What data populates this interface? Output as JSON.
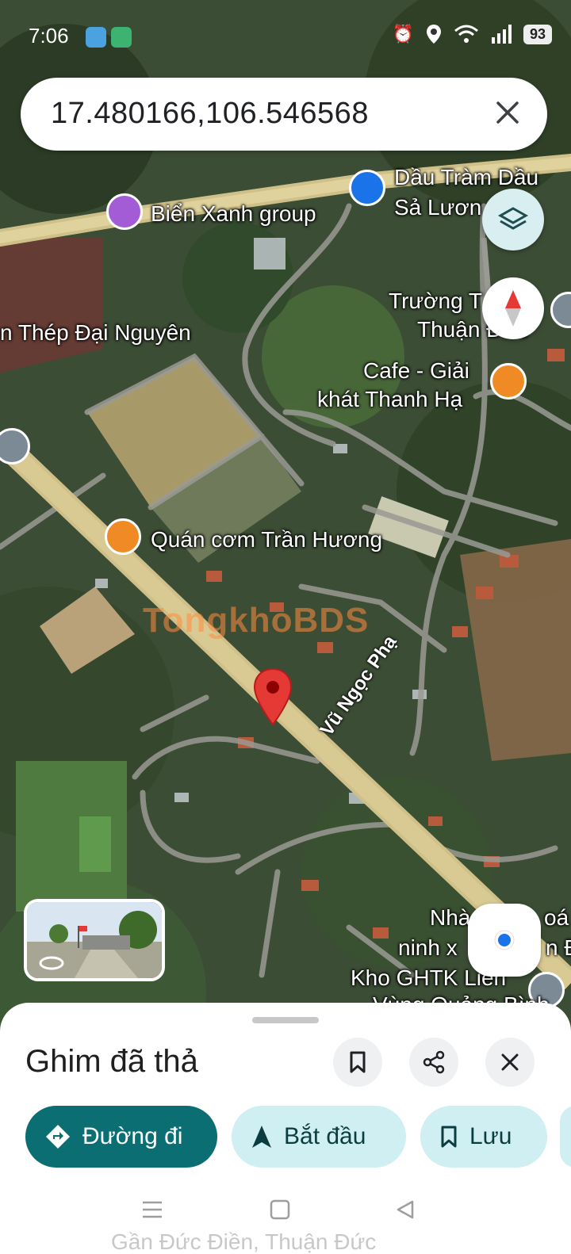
{
  "status_bar": {
    "time": "7:06",
    "battery": "93"
  },
  "search": {
    "query": "17.480166,106.546568"
  },
  "map": {
    "labels": {
      "bien_xanh": "Biển Xanh group",
      "dau_tram_1": "Dầu Tràm Dầu",
      "dau_tram_2": "Sả Lươn",
      "dai_nguyen": "n Thép Đại Nguyên",
      "truong_1": "Trường T",
      "truong_2": "Thuận Đức",
      "cafe_1": "Cafe - Giải",
      "cafe_2": "khát Thanh Hạ",
      "quan_com": "Quán cơm Trần Hương",
      "street": "Vũ Ngọc Phạ",
      "nha_1": "Nhà",
      "nha_1b": "oá",
      "nha_2": "ninh x",
      "nha_2b": "n Đ",
      "kho": "Kho GHTK Liên",
      "vung": "Vùng Quảng Bình"
    },
    "watermark": "TongkhoBDS"
  },
  "sheet": {
    "title": "Ghim đã thả",
    "chips": {
      "directions": "Đường đi",
      "start": "Bắt đầu",
      "save": "Lưu"
    },
    "faded_address": "Gần Đức Điền, Thuận Đức"
  },
  "colors": {
    "accent": "#0b6e72",
    "pin": "#e53935",
    "road": "#d9c48a",
    "chip_bg": "#cfeff2"
  }
}
